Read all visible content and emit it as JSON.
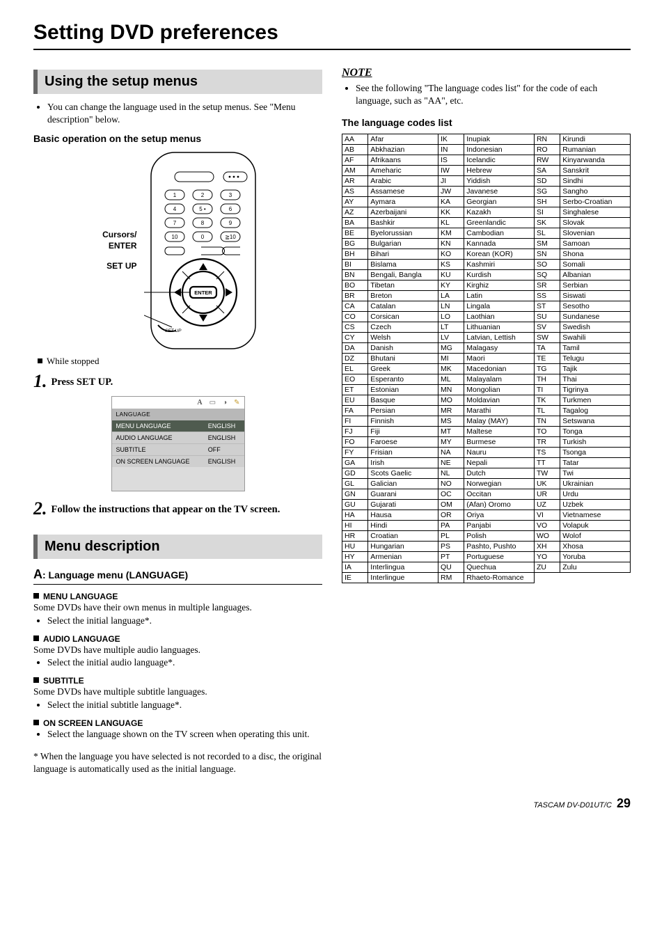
{
  "page_title": "Setting DVD preferences",
  "left": {
    "section1_title": "Using the setup menus",
    "section1_note": "You can change the language used in the setup menus. See \"Menu description\" below.",
    "basic_op": "Basic operation on the setup menus",
    "remote_labels": {
      "line1": "Cursors/",
      "line2": "ENTER",
      "line3": "SET UP",
      "enter_btn": "ENTER",
      "setup_btn": "SET UP",
      "ge10": "≧10"
    },
    "while_stopped": "While stopped",
    "step1": {
      "num": "1.",
      "text": "Press SET UP."
    },
    "osd": {
      "header": "LANGUAGE",
      "rows": [
        {
          "label": "MENU LANGUAGE",
          "value": "ENGLISH",
          "sel": true
        },
        {
          "label": "AUDIO LANGUAGE",
          "value": "ENGLISH",
          "sel": false
        },
        {
          "label": "SUBTITLE",
          "value": "OFF",
          "sel": false
        },
        {
          "label": "ON SCREEN LANGUAGE",
          "value": "ENGLISH",
          "sel": false
        }
      ]
    },
    "step2": {
      "num": "2.",
      "text": "Follow the instructions that appear on the TV screen."
    },
    "section2_title": "Menu description",
    "lang_menu_heading": ": Language menu (LANGUAGE)",
    "items": [
      {
        "h": "MENU LANGUAGE",
        "p": "Some DVDs have their own menus in multiple languages.",
        "b": "Select the initial language*."
      },
      {
        "h": "AUDIO LANGUAGE",
        "p": "Some DVDs have multiple audio languages.",
        "b": "Select the initial audio language*."
      },
      {
        "h": "SUBTITLE",
        "p": "Some DVDs have multiple subtitle languages.",
        "b": "Select the initial subtitle language*."
      },
      {
        "h": "ON SCREEN LANGUAGE",
        "p": "",
        "b": "Select the language shown on the TV screen when operating this unit."
      }
    ],
    "footnote": "* When the language you have selected is not recorded to a disc, the original language is automatically used as the initial language."
  },
  "right": {
    "note_label": "NOTE",
    "note_text": "See the following \"The language codes list\" for the code of each language, such as \"AA\", etc.",
    "codes_title": "The language codes list",
    "codes": [
      [
        [
          "AA",
          "Afar"
        ],
        [
          "IK",
          "Inupiak"
        ],
        [
          "RN",
          "Kirundi"
        ]
      ],
      [
        [
          "AB",
          "Abkhazian"
        ],
        [
          "IN",
          "Indonesian"
        ],
        [
          "RO",
          "Rumanian"
        ]
      ],
      [
        [
          "AF",
          "Afrikaans"
        ],
        [
          "IS",
          "Icelandic"
        ],
        [
          "RW",
          "Kinyarwanda"
        ]
      ],
      [
        [
          "AM",
          "Ameharic"
        ],
        [
          "IW",
          "Hebrew"
        ],
        [
          "SA",
          "Sanskrit"
        ]
      ],
      [
        [
          "AR",
          "Arabic"
        ],
        [
          "JI",
          "Yiddish"
        ],
        [
          "SD",
          "Sindhi"
        ]
      ],
      [
        [
          "AS",
          "Assamese"
        ],
        [
          "JW",
          "Javanese"
        ],
        [
          "SG",
          "Sangho"
        ]
      ],
      [
        [
          "AY",
          "Aymara"
        ],
        [
          "KA",
          "Georgian"
        ],
        [
          "SH",
          "Serbo-Croatian"
        ]
      ],
      [
        [
          "AZ",
          "Azerbaijani"
        ],
        [
          "KK",
          "Kazakh"
        ],
        [
          "SI",
          "Singhalese"
        ]
      ],
      [
        [
          "BA",
          "Bashkir"
        ],
        [
          "KL",
          "Greenlandic"
        ],
        [
          "SK",
          "Slovak"
        ]
      ],
      [
        [
          "BE",
          "Byelorussian"
        ],
        [
          "KM",
          "Cambodian"
        ],
        [
          "SL",
          "Slovenian"
        ]
      ],
      [
        [
          "BG",
          "Bulgarian"
        ],
        [
          "KN",
          "Kannada"
        ],
        [
          "SM",
          "Samoan"
        ]
      ],
      [
        [
          "BH",
          "Bihari"
        ],
        [
          "KO",
          "Korean (KOR)"
        ],
        [
          "SN",
          "Shona"
        ]
      ],
      [
        [
          "BI",
          "Bislama"
        ],
        [
          "KS",
          "Kashmiri"
        ],
        [
          "SO",
          "Somali"
        ]
      ],
      [
        [
          "BN",
          "Bengali, Bangla"
        ],
        [
          "KU",
          "Kurdish"
        ],
        [
          "SQ",
          "Albanian"
        ]
      ],
      [
        [
          "BO",
          "Tibetan"
        ],
        [
          "KY",
          "Kirghiz"
        ],
        [
          "SR",
          "Serbian"
        ]
      ],
      [
        [
          "BR",
          "Breton"
        ],
        [
          "LA",
          "Latin"
        ],
        [
          "SS",
          "Siswati"
        ]
      ],
      [
        [
          "CA",
          "Catalan"
        ],
        [
          "LN",
          "Lingala"
        ],
        [
          "ST",
          "Sesotho"
        ]
      ],
      [
        [
          "CO",
          "Corsican"
        ],
        [
          "LO",
          "Laothian"
        ],
        [
          "SU",
          "Sundanese"
        ]
      ],
      [
        [
          "CS",
          "Czech"
        ],
        [
          "LT",
          "Lithuanian"
        ],
        [
          "SV",
          "Swedish"
        ]
      ],
      [
        [
          "CY",
          "Welsh"
        ],
        [
          "LV",
          "Latvian, Lettish"
        ],
        [
          "SW",
          "Swahili"
        ]
      ],
      [
        [
          "DA",
          "Danish"
        ],
        [
          "MG",
          "Malagasy"
        ],
        [
          "TA",
          "Tamil"
        ]
      ],
      [
        [
          "DZ",
          "Bhutani"
        ],
        [
          "MI",
          "Maori"
        ],
        [
          "TE",
          "Telugu"
        ]
      ],
      [
        [
          "EL",
          "Greek"
        ],
        [
          "MK",
          "Macedonian"
        ],
        [
          "TG",
          "Tajik"
        ]
      ],
      [
        [
          "EO",
          "Esperanto"
        ],
        [
          "ML",
          "Malayalam"
        ],
        [
          "TH",
          "Thai"
        ]
      ],
      [
        [
          "ET",
          "Estonian"
        ],
        [
          "MN",
          "Mongolian"
        ],
        [
          "TI",
          "Tigrinya"
        ]
      ],
      [
        [
          "EU",
          "Basque"
        ],
        [
          "MO",
          "Moldavian"
        ],
        [
          "TK",
          "Turkmen"
        ]
      ],
      [
        [
          "FA",
          "Persian"
        ],
        [
          "MR",
          "Marathi"
        ],
        [
          "TL",
          "Tagalog"
        ]
      ],
      [
        [
          "FI",
          "Finnish"
        ],
        [
          "MS",
          "Malay (MAY)"
        ],
        [
          "TN",
          "Setswana"
        ]
      ],
      [
        [
          "FJ",
          "Fiji"
        ],
        [
          "MT",
          "Maltese"
        ],
        [
          "TO",
          "Tonga"
        ]
      ],
      [
        [
          "FO",
          "Faroese"
        ],
        [
          "MY",
          "Burmese"
        ],
        [
          "TR",
          "Turkish"
        ]
      ],
      [
        [
          "FY",
          "Frisian"
        ],
        [
          "NA",
          "Nauru"
        ],
        [
          "TS",
          "Tsonga"
        ]
      ],
      [
        [
          "GA",
          "Irish"
        ],
        [
          "NE",
          "Nepali"
        ],
        [
          "TT",
          "Tatar"
        ]
      ],
      [
        [
          "GD",
          "Scots Gaelic"
        ],
        [
          "NL",
          "Dutch"
        ],
        [
          "TW",
          "Twi"
        ]
      ],
      [
        [
          "GL",
          "Galician"
        ],
        [
          "NO",
          "Norwegian"
        ],
        [
          "UK",
          "Ukrainian"
        ]
      ],
      [
        [
          "GN",
          "Guarani"
        ],
        [
          "OC",
          "Occitan"
        ],
        [
          "UR",
          "Urdu"
        ]
      ],
      [
        [
          "GU",
          "Gujarati"
        ],
        [
          "OM",
          "(Afan) Oromo"
        ],
        [
          "UZ",
          "Uzbek"
        ]
      ],
      [
        [
          "HA",
          "Hausa"
        ],
        [
          "OR",
          "Oriya"
        ],
        [
          "VI",
          "Vietnamese"
        ]
      ],
      [
        [
          "HI",
          "Hindi"
        ],
        [
          "PA",
          "Panjabi"
        ],
        [
          "VO",
          "Volapuk"
        ]
      ],
      [
        [
          "HR",
          "Croatian"
        ],
        [
          "PL",
          "Polish"
        ],
        [
          "WO",
          "Wolof"
        ]
      ],
      [
        [
          "HU",
          "Hungarian"
        ],
        [
          "PS",
          "Pashto, Pushto"
        ],
        [
          "XH",
          "Xhosa"
        ]
      ],
      [
        [
          "HY",
          "Armenian"
        ],
        [
          "PT",
          "Portuguese"
        ],
        [
          "YO",
          "Yoruba"
        ]
      ],
      [
        [
          "IA",
          "Interlingua"
        ],
        [
          "QU",
          "Quechua"
        ],
        [
          "ZU",
          "Zulu"
        ]
      ],
      [
        [
          "IE",
          "Interlingue"
        ],
        [
          "RM",
          "Rhaeto-Romance"
        ],
        [
          "",
          ""
        ]
      ]
    ]
  },
  "footer": {
    "model": "TASCAM DV-D01UT/C",
    "page": "29"
  }
}
